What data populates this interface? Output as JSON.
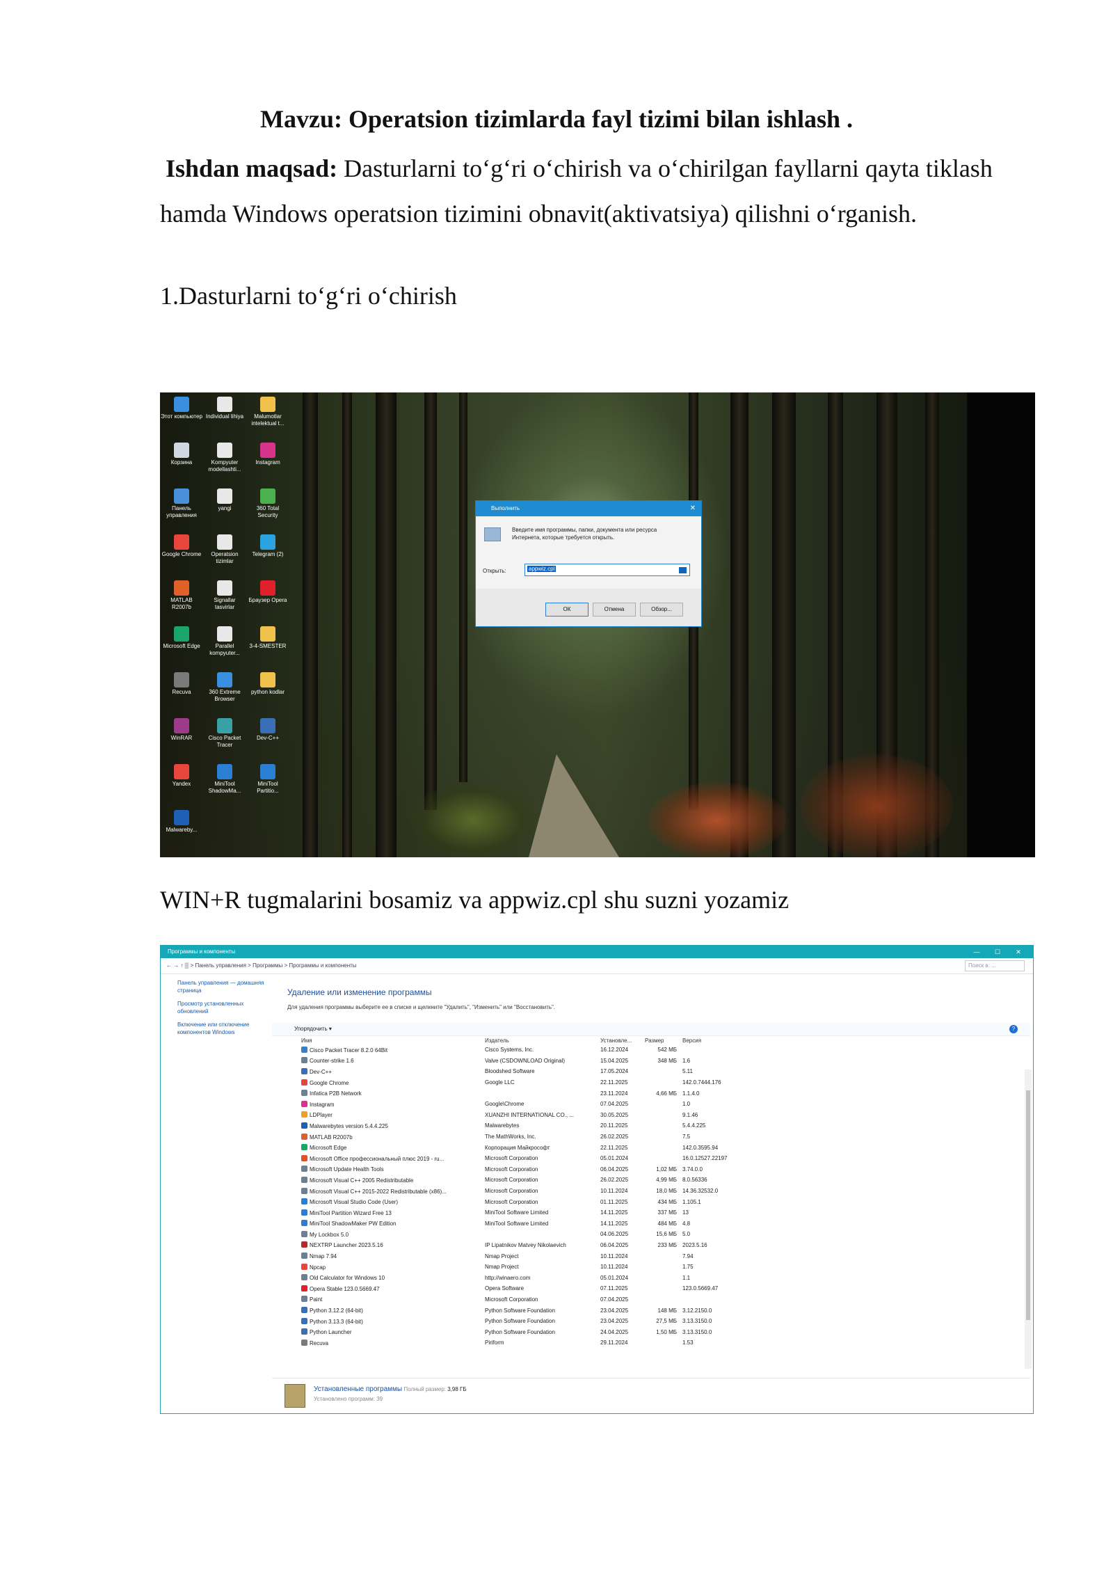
{
  "doc": {
    "title": "Mavzu: Operatsion tizimlarda fayl tizimi bilan ishlash .",
    "goal_label": "Ishdan maqsad:",
    "goal_text": " Dasturlarni to‘g‘ri o‘chirish va o‘chirilgan fayllarni qayta tiklash",
    "goal_text_cont": "hamda Windows operatsion tizimini obnavit(aktivatsiya) qilishni o‘rganish.",
    "section1": "1.Dasturlarni to‘g‘ri o‘chirish",
    "caption1": "WIN+R tugmalarini bosamiz va appwiz.cpl shu suzni yozamiz"
  },
  "desktop": {
    "icons": [
      {
        "label": "Этот компьютер",
        "color": "#3a8fe0"
      },
      {
        "label": "Individual lihiya",
        "color": "#e8e8e8"
      },
      {
        "label": "Malumotlar intelektual t...",
        "color": "#f0c24b"
      },
      {
        "label": "Корзина",
        "color": "#cfd8e0"
      },
      {
        "label": "Kompyuter modellashti...",
        "color": "#e8e8e8"
      },
      {
        "label": "Instagram",
        "color": "#d8338a"
      },
      {
        "label": "Панель управления",
        "color": "#4a90d9"
      },
      {
        "label": "yangi",
        "color": "#e8e8e8"
      },
      {
        "label": "360 Total Security",
        "color": "#4caf50"
      },
      {
        "label": "Google Chrome",
        "color": "#e8453c"
      },
      {
        "label": "Operatsion tizimlar",
        "color": "#e8e8e8"
      },
      {
        "label": "Telegram (2)",
        "color": "#2aa3e0"
      },
      {
        "label": "MATLAB R2007b",
        "color": "#e0602a"
      },
      {
        "label": "Signallar tasvirlar",
        "color": "#e8e8e8"
      },
      {
        "label": "Браузер Opera",
        "color": "#e0202a"
      },
      {
        "label": "Microsoft Edge",
        "color": "#1aa56b"
      },
      {
        "label": "Parallel kompyuter...",
        "color": "#e8e8e8"
      },
      {
        "label": "3-4-SMESTER",
        "color": "#f0c24b"
      },
      {
        "label": "Recuva",
        "color": "#7a7a7a"
      },
      {
        "label": "360 Extreme Browser",
        "color": "#3a8fe0"
      },
      {
        "label": "python kodlar",
        "color": "#f0c24b"
      },
      {
        "label": "WinRAR",
        "color": "#9b3b8a"
      },
      {
        "label": "Cisco Packet Tracer",
        "color": "#3aa0a8"
      },
      {
        "label": "Dev-C++",
        "color": "#3a6fb8"
      },
      {
        "label": "Yandex",
        "color": "#e8453c"
      },
      {
        "label": "MiniTool ShadowMa...",
        "color": "#2a7fd4"
      },
      {
        "label": "MiniTool Partitio...",
        "color": "#2a7fd4"
      },
      {
        "label": "Malwareby...",
        "color": "#1f5fb5"
      }
    ]
  },
  "run_dialog": {
    "title": "Выполнить",
    "close": "✕",
    "description": "Введите имя программы, папки, документа или ресурса Интернета, которые требуется открыть.",
    "open_label": "Открыть:",
    "input_value": "appwiz.cpl",
    "ok": "ОК",
    "cancel": "Отмена",
    "browse": "Обзор..."
  },
  "programs_window": {
    "title": "Программы и компоненты",
    "address": "←  →  ↑  ▒  >  Панель управления  >  Программы  >  Программы и компоненты",
    "search_placeholder": "Поиск в: ...",
    "sidebar": [
      "Панель управления — домашняя страница",
      "Просмотр установленных обновлений",
      "Включение или отключение компонентов Windows"
    ],
    "heading": "Удаление или изменение программы",
    "subheading": "Для удаления программы выберите ее в списке и щелкните \"Удалить\", \"Изменить\" или \"Восстановить\".",
    "organize": "Упорядочить ▾",
    "columns": [
      "Имя",
      "Издатель",
      "Установле...",
      "Размер",
      "Версия"
    ],
    "rows": [
      {
        "name": "Cisco Packet Tracer 8.2.0 64Bit",
        "publisher": "Cisco Systems, Inc.",
        "date": "16.12.2024",
        "size": "542 МБ",
        "version": "",
        "color": "#3a7fc4"
      },
      {
        "name": "Counter-strike 1.6",
        "publisher": "Valve (CSDOWNLOAD Original)",
        "date": "15.04.2025",
        "size": "348 МБ",
        "version": "1.6",
        "color": "#6b7f95"
      },
      {
        "name": "Dev-C++",
        "publisher": "Bloodshed Software",
        "date": "17.05.2024",
        "size": "",
        "version": "5.11",
        "color": "#3a6fb8"
      },
      {
        "name": "Google Chrome",
        "publisher": "Google LLC",
        "date": "22.11.2025",
        "size": "",
        "version": "142.0.7444.176",
        "color": "#e8453c"
      },
      {
        "name": "Infatica P2B Network",
        "publisher": "",
        "date": "23.11.2024",
        "size": "4,66 МБ",
        "version": "1.1.4.0",
        "color": "#6b7f95"
      },
      {
        "name": "Instagram",
        "publisher": "Google\\Chrome",
        "date": "07.04.2025",
        "size": "",
        "version": "1.0",
        "color": "#d8338a"
      },
      {
        "name": "LDPlayer",
        "publisher": "XUANZHI INTERNATIONAL CO., ...",
        "date": "30.05.2025",
        "size": "",
        "version": "9.1.46",
        "color": "#f0a020"
      },
      {
        "name": "Malwarebytes version 5.4.4.225",
        "publisher": "Malwarebytes",
        "date": "20.11.2025",
        "size": "",
        "version": "5.4.4.225",
        "color": "#1f5fb5"
      },
      {
        "name": "MATLAB R2007b",
        "publisher": "The MathWorks, Inc.",
        "date": "26.02.2025",
        "size": "",
        "version": "7.5",
        "color": "#e0602a"
      },
      {
        "name": "Microsoft Edge",
        "publisher": "Корпорация Майкрософт",
        "date": "22.11.2025",
        "size": "",
        "version": "142.0.3595.94",
        "color": "#1aa56b"
      },
      {
        "name": "Microsoft Office профессиональный плюс 2019 - ru...",
        "publisher": "Microsoft Corporation",
        "date": "05.01.2024",
        "size": "",
        "version": "16.0.12527.22197",
        "color": "#e0502a"
      },
      {
        "name": "Microsoft Update Health Tools",
        "publisher": "Microsoft Corporation",
        "date": "06.04.2025",
        "size": "1,02 МБ",
        "version": "3.74.0.0",
        "color": "#6b7f95"
      },
      {
        "name": "Microsoft Visual C++ 2005 Redistributable",
        "publisher": "Microsoft Corporation",
        "date": "26.02.2025",
        "size": "4,99 МБ",
        "version": "8.0.56336",
        "color": "#6b7f95"
      },
      {
        "name": "Microsoft Visual C++ 2015-2022 Redistributable (x86)...",
        "publisher": "Microsoft Corporation",
        "date": "10.11.2024",
        "size": "18,0 МБ",
        "version": "14.36.32532.0",
        "color": "#6b7f95"
      },
      {
        "name": "Microsoft Visual Studio Code (User)",
        "publisher": "Microsoft Corporation",
        "date": "01.11.2025",
        "size": "434 МБ",
        "version": "1.105.1",
        "color": "#2a7fd4"
      },
      {
        "name": "MiniTool Partition Wizard Free 13",
        "publisher": "MiniTool Software Limited",
        "date": "14.11.2025",
        "size": "337 МБ",
        "version": "13",
        "color": "#2a7fd4"
      },
      {
        "name": "MiniTool ShadowMaker PW Edition",
        "publisher": "MiniTool Software Limited",
        "date": "14.11.2025",
        "size": "484 МБ",
        "version": "4.8",
        "color": "#2a7fd4"
      },
      {
        "name": "My Lockbox 5.0",
        "publisher": "",
        "date": "04.06.2025",
        "size": "15,6 МБ",
        "version": "5.0",
        "color": "#6b7f95"
      },
      {
        "name": "NEXTRP Launcher 2023.5.16",
        "publisher": "IP Lipatnikov Matvey Nikolaevich",
        "date": "06.04.2025",
        "size": "233 МБ",
        "version": "2023.5.16",
        "color": "#b82a2a"
      },
      {
        "name": "Nmap 7.94",
        "publisher": "Nmap Project",
        "date": "10.11.2024",
        "size": "",
        "version": "7.94",
        "color": "#6b7f95"
      },
      {
        "name": "Npcap",
        "publisher": "Nmap Project",
        "date": "10.11.2024",
        "size": "",
        "version": "1.75",
        "color": "#e8453c"
      },
      {
        "name": "Old Calculator for Windows 10",
        "publisher": "http://winaero.com",
        "date": "05.01.2024",
        "size": "",
        "version": "1.1",
        "color": "#6b7f95"
      },
      {
        "name": "Opera Stable 123.0.5669.47",
        "publisher": "Opera Software",
        "date": "07.11.2025",
        "size": "",
        "version": "123.0.5669.47",
        "color": "#e0202a"
      },
      {
        "name": "Paint",
        "publisher": "Microsoft Corporation",
        "date": "07.04.2025",
        "size": "",
        "version": "",
        "color": "#6b7f95"
      },
      {
        "name": "Python 3.12.2 (64-bit)",
        "publisher": "Python Software Foundation",
        "date": "23.04.2025",
        "size": "148 МБ",
        "version": "3.12.2150.0",
        "color": "#3a6fb8"
      },
      {
        "name": "Python 3.13.3 (64-bit)",
        "publisher": "Python Software Foundation",
        "date": "23.04.2025",
        "size": "27,5 МБ",
        "version": "3.13.3150.0",
        "color": "#3a6fb8"
      },
      {
        "name": "Python Launcher",
        "publisher": "Python Software Foundation",
        "date": "24.04.2025",
        "size": "1,50 МБ",
        "version": "3.13.3150.0",
        "color": "#3a6fb8"
      },
      {
        "name": "Recuva",
        "publisher": "Piriform",
        "date": "29.11.2024",
        "size": "",
        "version": "1.53",
        "color": "#7a7a7a"
      }
    ],
    "status_title": "Установленные программы",
    "status_size_label": "Полный размер:",
    "status_size": "3,98 ГБ",
    "status_count": "Установлено программ: 39"
  }
}
